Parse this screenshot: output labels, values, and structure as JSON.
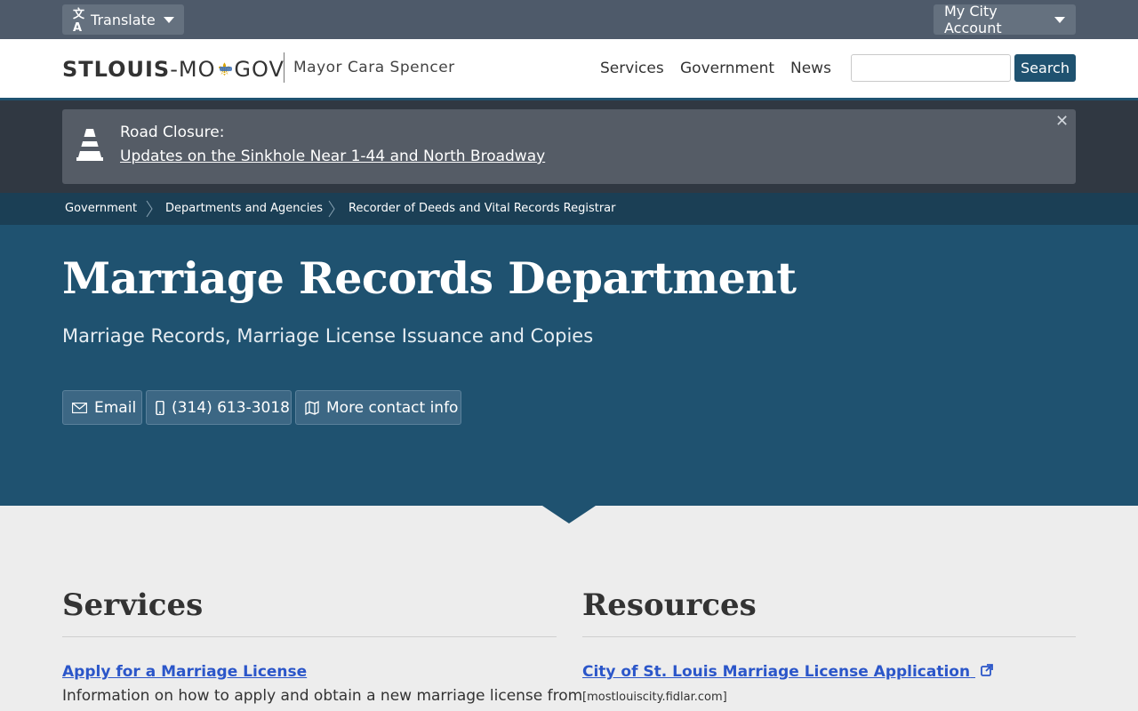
{
  "topbar": {
    "translate_label": "Translate",
    "account_label": "My City Account"
  },
  "header": {
    "logo_bold": "STLOUIS",
    "logo_dash": "-MO",
    "logo_gov": "GOV",
    "mayor": "Mayor Cara Spencer",
    "nav": [
      "Services",
      "Government",
      "News"
    ],
    "search_placeholder": "",
    "search_button": "Search"
  },
  "alert": {
    "label": "Road Closure:",
    "link": "Updates on the Sinkhole Near 1-44 and North Broadway",
    "close": "✕"
  },
  "breadcrumb": [
    "Government",
    "Departments and Agencies",
    "Recorder of Deeds and Vital Records Registrar"
  ],
  "hero": {
    "title": "Marriage Records Department",
    "subtitle": "Marriage Records, Marriage License Issuance and Copies",
    "buttons": {
      "email": "Email",
      "phone": "(314) 613-3018",
      "more": "More contact info"
    }
  },
  "services": {
    "heading": "Services",
    "link": "Apply for a Marriage License",
    "desc": "Information on how to apply and obtain a new marriage license from"
  },
  "resources": {
    "heading": "Resources",
    "link": "City of St. Louis Marriage License Application",
    "domain": "[mostlouiscity.fidlar.com]"
  },
  "colors": {
    "topbar": "#4e5a6a",
    "primary": "#1f5270",
    "breadcrumb": "#1b3f55",
    "alert_band": "#303842",
    "link": "#2b56c9"
  }
}
